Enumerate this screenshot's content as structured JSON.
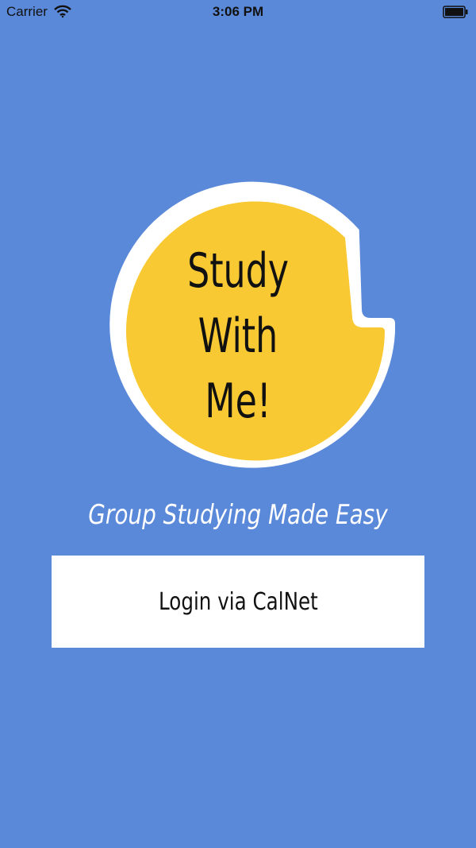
{
  "status_bar": {
    "carrier": "Carrier",
    "time": "3:06 PM",
    "wifi_icon": "wifi-icon",
    "battery_icon": "battery-icon"
  },
  "logo": {
    "lines": [
      "Study",
      "With",
      "Me!"
    ],
    "fill_color": "#f9c933",
    "ring_color": "#ffffff",
    "text_color": "#111111"
  },
  "tagline": "Group Studying Made Easy",
  "login_button": {
    "label": "Login via CalNet"
  },
  "colors": {
    "background": "#5b89d9",
    "button_background": "#ffffff"
  }
}
